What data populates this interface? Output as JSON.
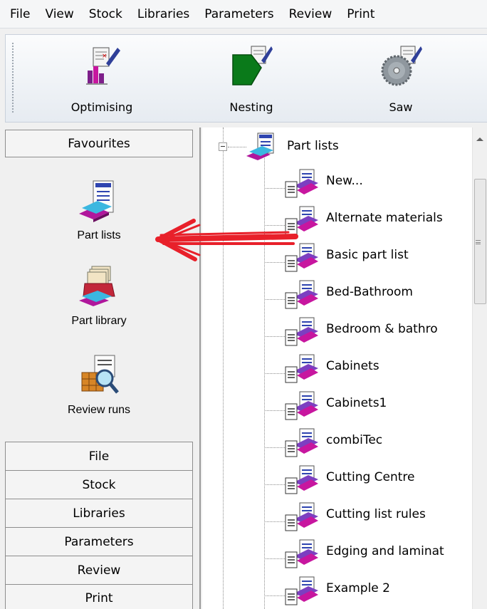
{
  "menu": [
    "File",
    "View",
    "Stock",
    "Libraries",
    "Parameters",
    "Review",
    "Print"
  ],
  "toolbar": {
    "buttons": [
      {
        "label": "Optimising",
        "icon": "optimising-chart-icon"
      },
      {
        "label": "Nesting",
        "icon": "nesting-shape-icon"
      },
      {
        "label": "Saw",
        "icon": "saw-blade-icon"
      }
    ]
  },
  "left_panel": {
    "favourites_header": "Favourites",
    "favourites": [
      {
        "label": "Part lists",
        "icon": "part-lists-icon"
      },
      {
        "label": "Part library",
        "icon": "part-library-icon"
      },
      {
        "label": "Review runs",
        "icon": "review-runs-icon"
      }
    ],
    "nav_buttons": [
      "File",
      "Stock",
      "Libraries",
      "Parameters",
      "Review",
      "Print"
    ]
  },
  "tree": {
    "root": {
      "label": "Part lists",
      "expanded": true
    },
    "items": [
      "New...",
      "Alternate materials",
      "Basic part list",
      "Bed-Bathroom",
      "Bedroom & bathro",
      "Cabinets",
      "Cabinets1",
      "combiTec",
      "Cutting Centre",
      "Cutting list rules",
      "Edging and laminat",
      "Example 2"
    ]
  },
  "colors": {
    "annotation_arrow": "#e8202a",
    "panel_bg": "#f0f0f0",
    "tree_bg": "#ffffff"
  }
}
